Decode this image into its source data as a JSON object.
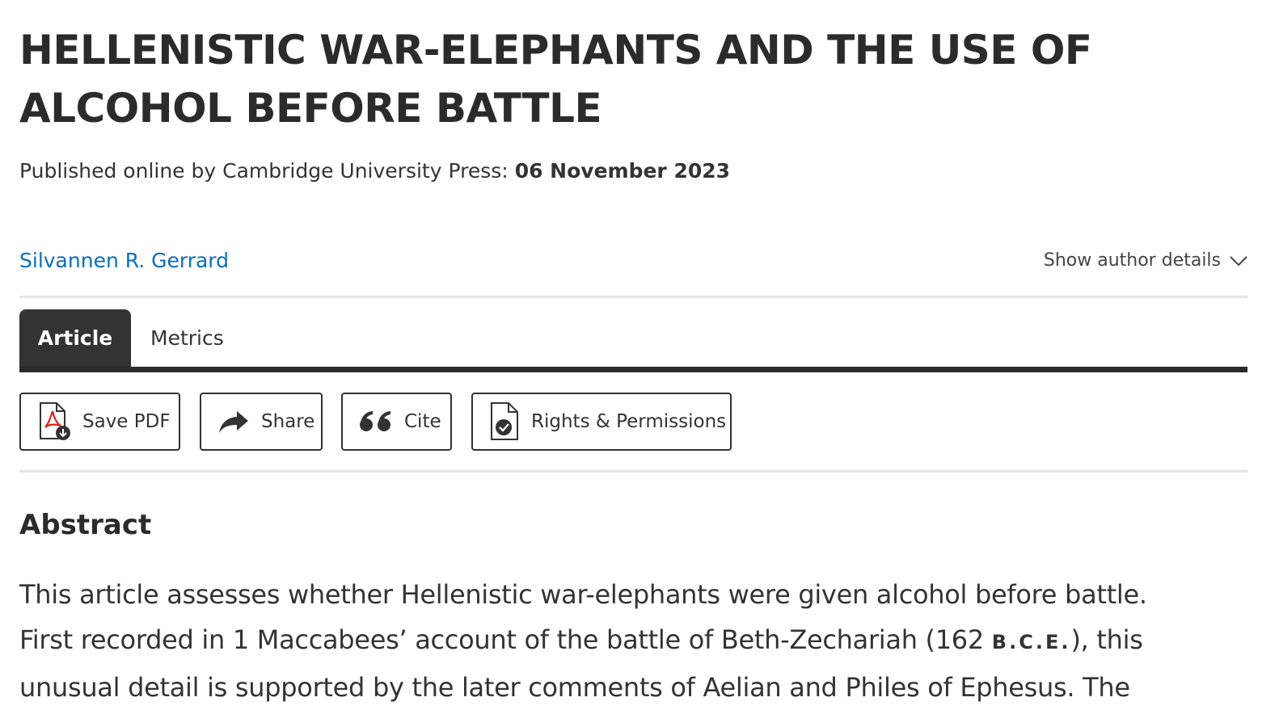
{
  "article": {
    "title": "HELLENISTIC WAR-ELEPHANTS AND THE USE OF ALCOHOL BEFORE BATTLE",
    "published_label": "Published online by Cambridge University Press:",
    "published_date": "06 November 2023"
  },
  "author": {
    "name": "Silvannen R. Gerrard",
    "details_toggle_label": "Show author details",
    "details_toggle_icon": "chevron-down-icon"
  },
  "tabs": [
    {
      "label": "Article",
      "active": true
    },
    {
      "label": "Metrics",
      "active": false
    }
  ],
  "toolbar": {
    "save_pdf_label": "Save PDF",
    "save_pdf_icon": "pdf-download-icon",
    "share_label": "Share",
    "share_icon": "share-arrow-icon",
    "cite_label": "Cite",
    "cite_icon": "quote-icon",
    "rights_label": "Rights & Permissions",
    "rights_icon": "document-check-icon"
  },
  "abstract": {
    "heading": "Abstract",
    "line1": "This article assesses whether Hellenistic war-elephants were given alcohol before battle.",
    "line2_before": "First recorded in 1 Maccabees’ account of the battle of Beth-Zechariah (162 ",
    "line2_era": "B.C.E.",
    "line2_after": "), this",
    "line3": "unusual detail is supported by the later comments of Aelian and Philes of Ephesus. The"
  },
  "colors": {
    "link": "#0a6ebd",
    "active_tab_bg": "#333333",
    "pdf_red": "#d9261c",
    "text": "#333333"
  }
}
